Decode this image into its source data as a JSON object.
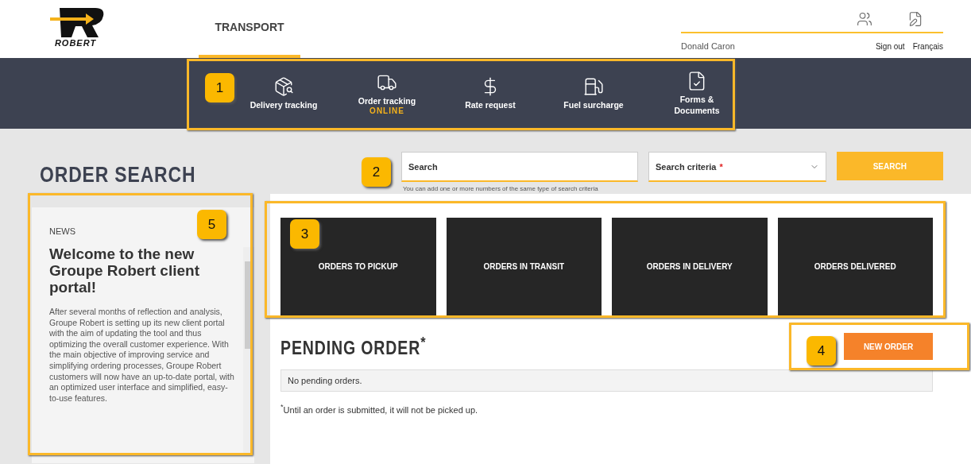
{
  "header": {
    "logo_text": "ROBERT",
    "tabs": [
      {
        "label": "TRANSPORT",
        "selected": true
      }
    ],
    "user_name": "Donald Caron",
    "links": [
      "Sign out",
      "Français"
    ]
  },
  "nav": [
    {
      "label": "Delivery tracking"
    },
    {
      "label": "Order tracking",
      "sub": "ONLINE"
    },
    {
      "label": "Rate request"
    },
    {
      "label": "Fuel surcharge"
    },
    {
      "label": "Forms & Documents"
    }
  ],
  "search": {
    "title": "ORDER SEARCH",
    "placeholder": "Search",
    "criteria": "Search criteria",
    "criteria_marker": "*",
    "button": "SEARCH",
    "hint": "You can add one or more numbers of the same type of search criteria"
  },
  "news": {
    "label": "NEWS",
    "title": "Welcome to the new Groupe Robert client portal!",
    "body": "After several months of reflection and analysis, Groupe Robert is setting up its new client portal with the aim of updating the tool and thus optimizing the overall customer experience. With the main objective of improving service and simplifying ordering processes, Groupe Robert customers will now have an up-to-date portal, with an optimized user interface and simplified, easy-to-use features."
  },
  "tiles": [
    "ORDERS TO PICKUP",
    "ORDERS IN TRANSIT",
    "ORDERS IN DELIVERY",
    "ORDERS DELIVERED"
  ],
  "pending": {
    "title": "PENDING ORDER$^{*}$",
    "button": "NEW ORDER",
    "empty": "No pending orders.",
    "footnote": "$^{*}$Until an order is submitted, it will not be picked up."
  },
  "annotations": [
    {
      "label": "1"
    },
    {
      "label": "2"
    },
    {
      "label": "3"
    },
    {
      "label": "4"
    },
    {
      "label": "5"
    }
  ]
}
